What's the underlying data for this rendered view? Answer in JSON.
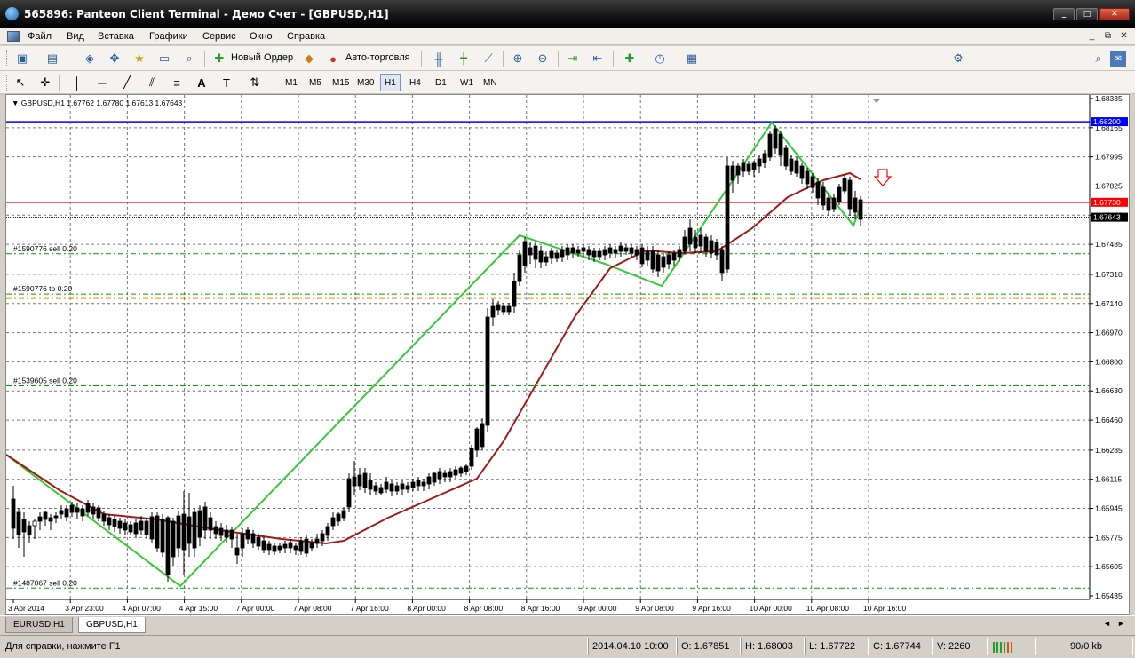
{
  "window": {
    "title": "565896: Panteon Client Terminal - Демо Счет - [GBPUSD,H1]",
    "min_label": "_",
    "max_label": "□",
    "close_label": "✕"
  },
  "menu": {
    "items": [
      "Файл",
      "Вид",
      "Вставка",
      "Графики",
      "Сервис",
      "Окно",
      "Справка"
    ],
    "mdi_min": "_",
    "mdi_restore": "⧉",
    "mdi_close": "✕"
  },
  "toolbar": {
    "new_order_label": "Новый Ордер",
    "auto_trading_label": "Авто-торговля"
  },
  "timeframes": {
    "items": [
      "M1",
      "M5",
      "M15",
      "M30",
      "H1",
      "H4",
      "D1",
      "W1",
      "MN"
    ],
    "active": "H1"
  },
  "chart": {
    "symbol_header": "GBPUSD,H1  1.67762 1.67780 1.67613 1.67643",
    "price_labels": [
      "1.68335",
      "1.68165",
      "1.67995",
      "1.67825",
      "1.67655",
      "1.67485",
      "1.67310",
      "1.67140",
      "1.66970",
      "1.66800",
      "1.66630",
      "1.66460",
      "1.66285",
      "1.66115",
      "1.65945",
      "1.65775",
      "1.65605",
      "1.65435"
    ],
    "time_labels": [
      "3 Apr 2014",
      "3 Apr 23:00",
      "4 Apr 07:00",
      "4 Apr 15:00",
      "7 Apr 00:00",
      "7 Apr 08:00",
      "7 Apr 16:00",
      "8 Apr 00:00",
      "8 Apr 08:00",
      "8 Apr 16:00",
      "9 Apr 00:00",
      "9 Apr 08:00",
      "9 Apr 16:00",
      "10 Apr 00:00",
      "10 Apr 08:00",
      "10 Apr 16:00"
    ],
    "hlines": [
      {
        "price": 1.682,
        "color": "#0000ff",
        "tag": "1.68200"
      },
      {
        "price": 1.6773,
        "color": "#ff0000",
        "tag": "1.67730"
      },
      {
        "price": 1.67643,
        "color": "#000000",
        "tag": "1.67643"
      }
    ],
    "orders": [
      {
        "label": "#1590776 sell 0.20",
        "price": 1.6743
      },
      {
        "label": "#1590776 tp 0.20",
        "price": 1.67195
      },
      {
        "label": "#1539605 sell 0.20",
        "price": 1.6666
      },
      {
        "label": "#1487067 sell 0.20",
        "price": 1.6548
      }
    ],
    "colors": {
      "zigzag": "#33cc33",
      "ma": "#a31a1a",
      "grid": "#777777",
      "arrow": "#ff0000"
    }
  },
  "tabs": {
    "items": [
      "EURUSD,H1",
      "GBPUSD,H1"
    ],
    "active": "GBPUSD,H1"
  },
  "status": {
    "help": "Для справки, нажмите F1",
    "datetime": "2014.04.10 10:00",
    "open": "O: 1.67851",
    "high": "H: 1.68003",
    "low": "L: 1.67722",
    "close": "C: 1.67744",
    "volume": "V: 2260",
    "traffic": "90/0 kb"
  }
}
